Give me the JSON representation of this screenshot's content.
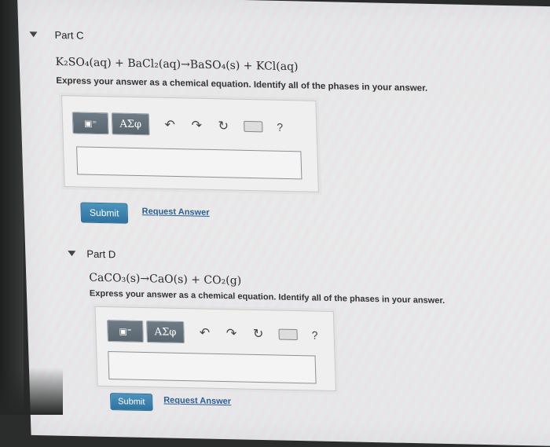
{
  "parts": [
    {
      "title": "Part C",
      "equation": "K₂SO₄(aq) + BaCl₂(aq)→BaSO₄(s) + KCl(aq)",
      "instruction": "Express your answer as a chemical equation. Identify all of the phases in your answer.",
      "toolbar": {
        "greek_label": "ΑΣφ",
        "help_label": "?"
      },
      "answer_value": "",
      "submit_label": "Submit",
      "request_label": "Request Answer"
    },
    {
      "title": "Part D",
      "equation": "CaCO₃(s)→CaO(s) + CO₂(g)",
      "instruction": "Express your answer as a chemical equation. Identify all of the phases in your answer.",
      "toolbar": {
        "greek_label": "ΑΣφ",
        "help_label": "?"
      },
      "answer_value": "",
      "submit_label": "Submit",
      "request_label": "Request Answer"
    }
  ],
  "icons": {
    "templates": "templates-icon",
    "undo": "undo-icon",
    "redo": "redo-icon",
    "reset": "reset-icon",
    "keyboard": "keyboard-icon",
    "help": "help-icon"
  },
  "colors": {
    "submit": "#3a80ad",
    "link": "#2c5f90"
  }
}
